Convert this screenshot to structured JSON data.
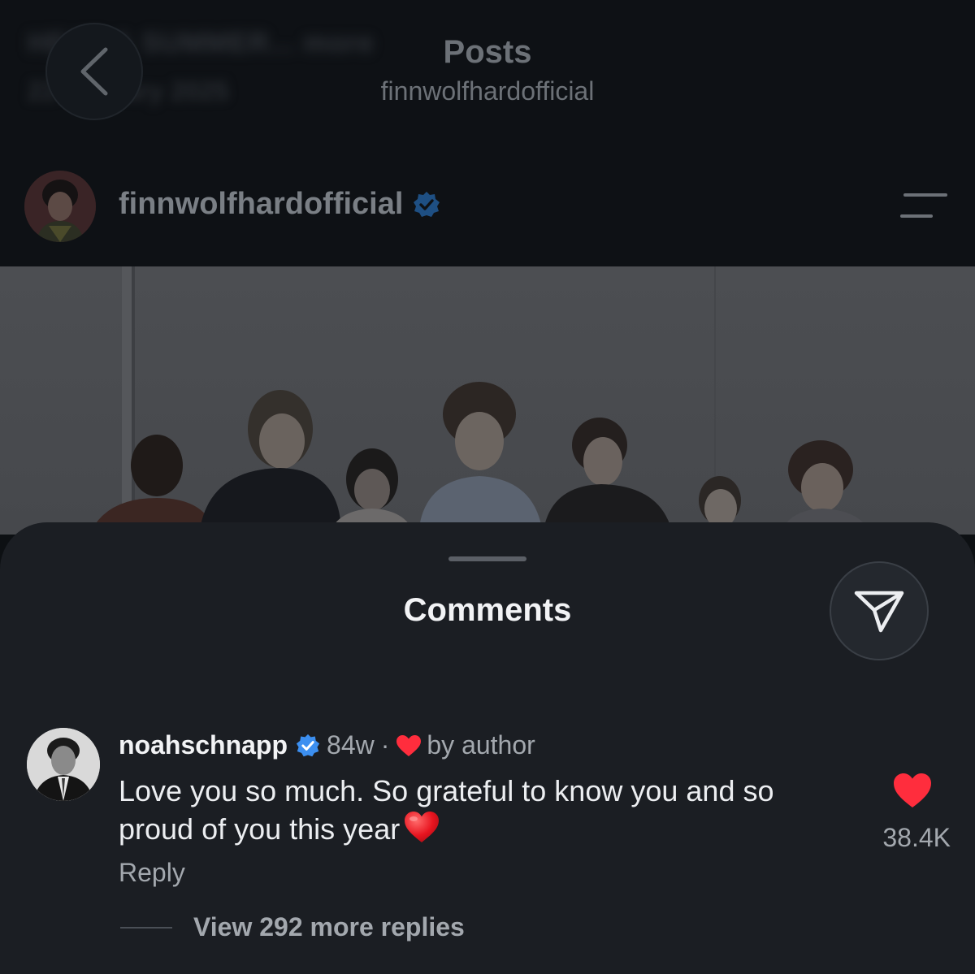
{
  "header": {
    "ghost_title": "HEAT & SUMMER... more",
    "ghost_date": "22 January 2025",
    "title": "Posts",
    "subtitle": "finnwolfhardofficial"
  },
  "post": {
    "username": "finnwolfhardofficial",
    "verified": true,
    "image_alt": "group photo of seven young people against a white wall"
  },
  "comments_sheet": {
    "title": "Comments"
  },
  "comment": {
    "username": "noahschnapp",
    "verified": true,
    "time": "84w",
    "separator": "·",
    "liked_by_label": "by author",
    "text": "Love you so much. So grateful to know you and so proud of you this year",
    "emoji": "red-heart",
    "reply_label": "Reply",
    "like_count": "38.4K",
    "view_replies_label": "View 292 more replies"
  },
  "colors": {
    "background": "#0d1013",
    "sheet": "#1b1e23",
    "verified_blue": "#3c8ff0",
    "like_red": "#ff2d3d",
    "text_primary": "#f2f3f5",
    "text_secondary": "#a3a8ae"
  },
  "icons": [
    "chevron-left-icon",
    "verified-badge-icon",
    "menu-icon",
    "send-icon",
    "heart-icon",
    "heart-emoji"
  ]
}
